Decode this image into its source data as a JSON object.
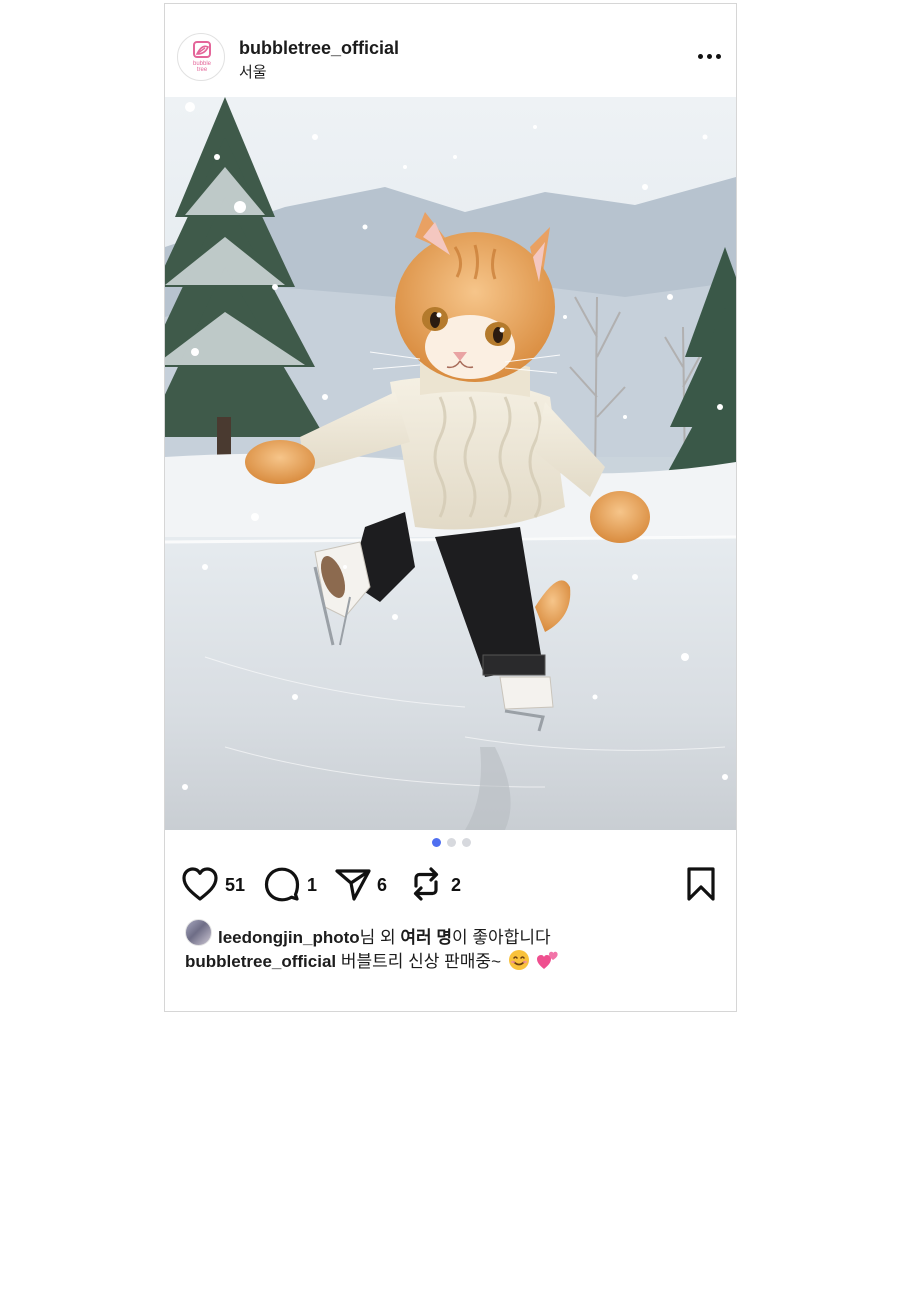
{
  "post": {
    "username": "bubbletree_official",
    "location": "서울",
    "avatar_logo_text": "bubble tree",
    "more_icon": "ellipsis-icon",
    "image_description_icon": "photo",
    "carousel": {
      "total": 3,
      "active_index": 0,
      "active_color": "#4f6ff0",
      "inactive_color": "#d7d9de"
    },
    "actions": {
      "like": {
        "icon": "heart-icon",
        "count": "51"
      },
      "comment": {
        "icon": "comment-icon",
        "count": "1"
      },
      "share": {
        "icon": "send-icon",
        "count": "6"
      },
      "repost": {
        "icon": "repost-icon",
        "count": "2"
      },
      "bookmark": {
        "icon": "bookmark-icon"
      }
    },
    "likes": {
      "liker_name": "leedongjin_photo",
      "middle_text": "님 외 ",
      "others_text": "여러 명",
      "suffix_text": "이 좋아합니다"
    },
    "caption": {
      "author": "bubbletree_official",
      "text": " 버블트리 신상 판매중~"
    },
    "colors": {
      "brand_pink": "#e4669a",
      "border": "#d6d6d6"
    }
  }
}
